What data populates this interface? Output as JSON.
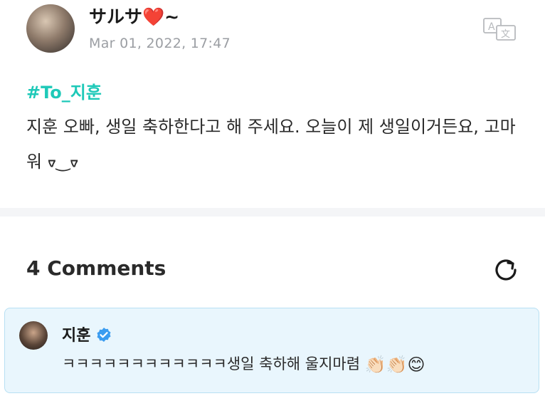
{
  "post": {
    "username": "サルサ",
    "username_heart": "❤️",
    "username_suffix": "~",
    "timestamp": "Mar 01, 2022, 17:47",
    "hashtag": "#To_지훈",
    "body": "지훈 오빠, 생일 축하한다고 해 주세요. 오늘이 제 생일이거든요, 고마워 ᢦ‿ᢦ"
  },
  "comments": {
    "title": "4 Comments",
    "items": [
      {
        "name": "지훈",
        "text": "ㅋㅋㅋㅋㅋㅋㅋㅋㅋㅋㅋㅋ생일 축하해 울지마렴 ",
        "emojis": "👏🏻👏🏻😊"
      }
    ]
  },
  "colors": {
    "hashtag": "#1ec9b8",
    "verified": "#3b9cf0",
    "comment_bg": "#e9f6fd"
  },
  "icons": [
    "translate-icon",
    "refresh-icon",
    "verified-icon"
  ]
}
